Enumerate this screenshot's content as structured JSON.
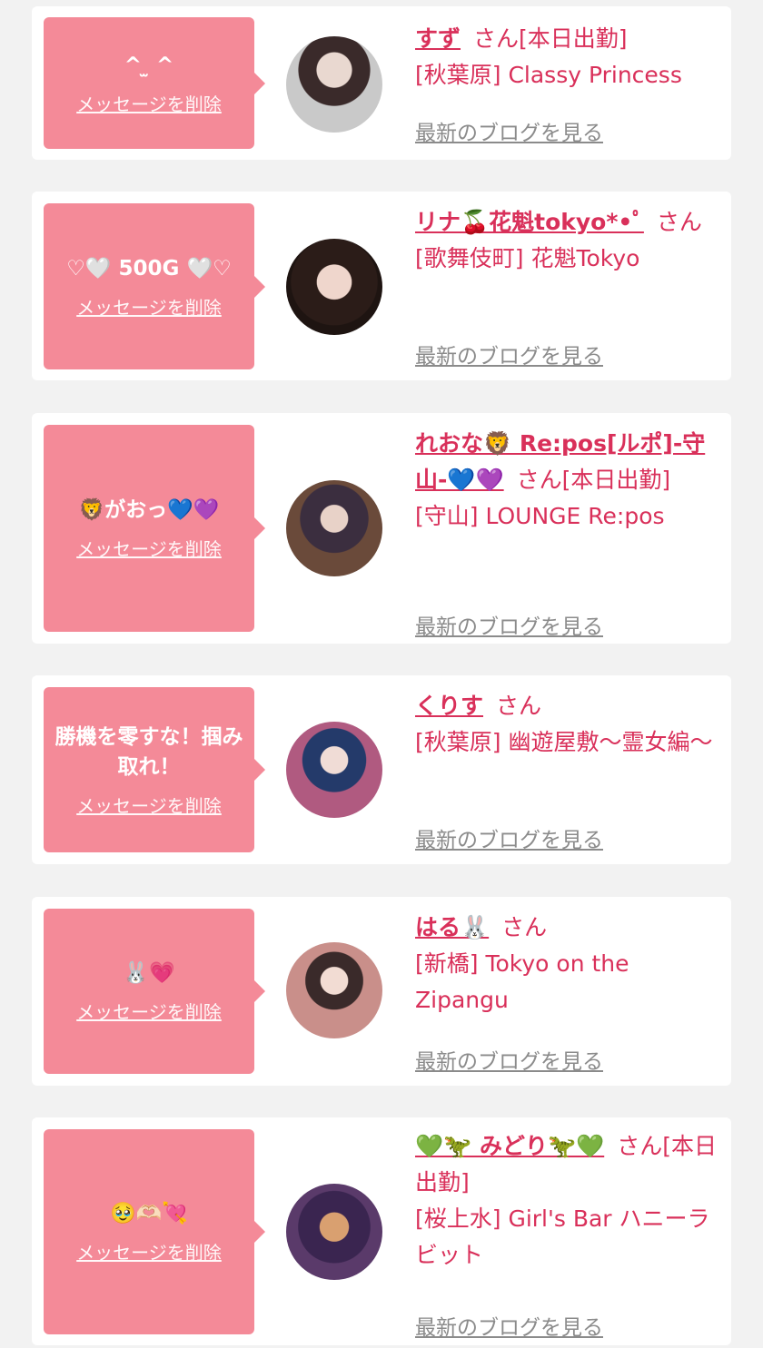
{
  "delete_label": "メッセージを削除",
  "blog_label": "最新のブログを見る",
  "suffix": "さん",
  "colors": {
    "bubble": "#f48a98",
    "accent": "#d9305a",
    "link_gray": "#8b8b8b"
  },
  "cards": [
    {
      "message": "^ ̫ ^",
      "name": "すず",
      "status": "[本日出勤]",
      "shop": "[秋葉原] Classy Princess"
    },
    {
      "message": "♡🤍 500G 🤍♡",
      "name": "リナ🍒花魁tokyo*•ﾟ",
      "status": "",
      "shop": "[歌舞伎町] 花魁Tokyo"
    },
    {
      "message": "🦁がおっ💙💜",
      "name": "れおな🦁 Re:pos[ルポ]-守山-💙💜",
      "status": "[本日出勤]",
      "shop": "[守山] LOUNGE Re:pos"
    },
    {
      "message": "勝機を零すな！掴み取れ！",
      "name": "くりす",
      "status": "",
      "shop": "[秋葉原] 幽遊屋敷〜霊女編〜"
    },
    {
      "message": "🐰💗",
      "name": "はる🐰",
      "status": "",
      "shop": "[新橋] Tokyo on the Zipangu"
    },
    {
      "message": "🥹🫶🏻💘",
      "name": "💚🦖 みどり🦖💚",
      "status": "[本日出勤]",
      "shop": "[桜上水] Girl's Bar ハニーラビット"
    }
  ]
}
